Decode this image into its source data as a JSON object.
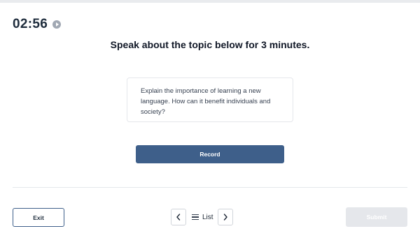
{
  "timer": {
    "value": "02:56",
    "icon": "play-circle-icon"
  },
  "instruction": "Speak about the topic below for 3 minutes.",
  "prompt": {
    "lines": [
      "Explain the importance of learning a new",
      "language. How can it benefit individuals and",
      "society?"
    ]
  },
  "actions": {
    "record_label": "Record"
  },
  "footer": {
    "exit_label": "Exit",
    "prev_icon": "chevron-left-icon",
    "next_icon": "chevron-right-icon",
    "list_icon": "list-icon",
    "list_label": "List",
    "submit_label": "Submit"
  },
  "colors": {
    "primary": "#3e5f8a",
    "timer_text": "#1f2d3d",
    "submit_disabled_bg": "#e5e7eb"
  }
}
